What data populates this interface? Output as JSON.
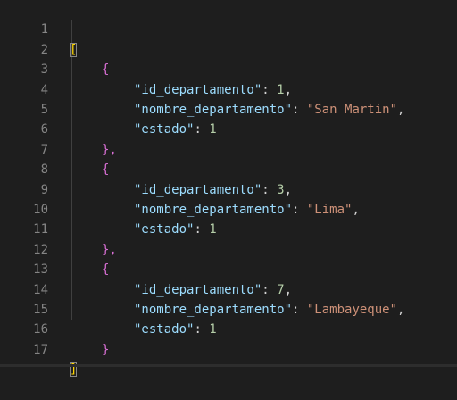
{
  "editor": {
    "line_numbers": [
      "1",
      "2",
      "3",
      "4",
      "5",
      "6",
      "7",
      "8",
      "9",
      "10",
      "11",
      "12",
      "13",
      "14",
      "15",
      "16",
      "17"
    ],
    "outer_open": "[",
    "outer_close": "]",
    "obj_open": "{",
    "obj_close_comma": "},",
    "obj_close": "}",
    "objects": [
      {
        "k1": "\"id_departamento\"",
        "v1": "1",
        "k2": "\"nombre_departamento\"",
        "v2": "\"San Martin\"",
        "k3": "\"estado\"",
        "v3": "1"
      },
      {
        "k1": "\"id_departamento\"",
        "v1": "3",
        "k2": "\"nombre_departamento\"",
        "v2": "\"Lima\"",
        "k3": "\"estado\"",
        "v3": "1"
      },
      {
        "k1": "\"id_departamento\"",
        "v1": "7",
        "k2": "\"nombre_departamento\"",
        "v2": "\"Lambayeque\"",
        "k3": "\"estado\"",
        "v3": "1"
      }
    ],
    "colon": ": ",
    "comma": ","
  }
}
